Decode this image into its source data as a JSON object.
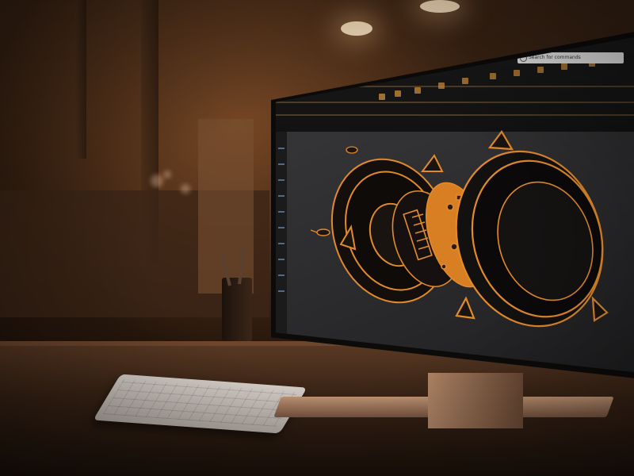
{
  "scene": {
    "description_tags": [
      "workshop",
      "desk",
      "keyboard",
      "monitor",
      "cad-model"
    ],
    "accent_color": "#e38b2a"
  },
  "cad_app": {
    "search_placeholder": "Search for commands"
  }
}
